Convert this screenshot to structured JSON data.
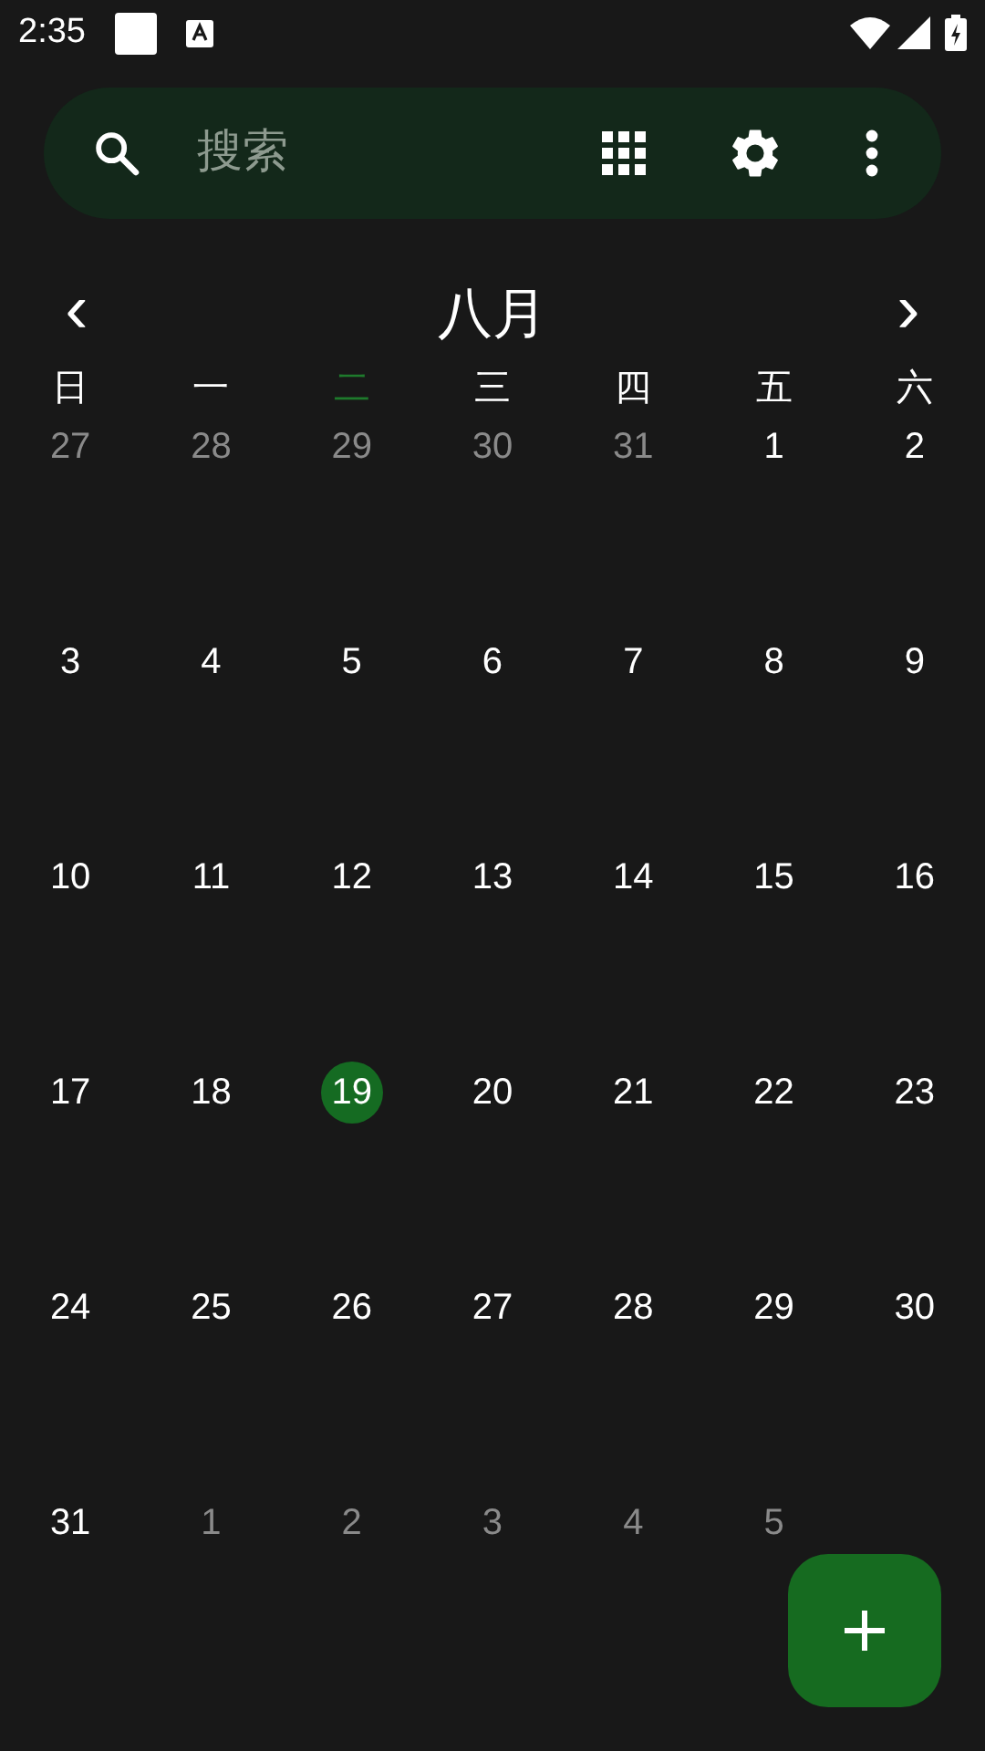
{
  "status_bar": {
    "time": "2:35"
  },
  "search": {
    "placeholder": "搜索"
  },
  "month": {
    "title": "八月",
    "prev": "‹",
    "next": "›"
  },
  "weekdays": [
    {
      "label": "日",
      "selected": false
    },
    {
      "label": "一",
      "selected": false
    },
    {
      "label": "二",
      "selected": true
    },
    {
      "label": "三",
      "selected": false
    },
    {
      "label": "四",
      "selected": false
    },
    {
      "label": "五",
      "selected": false
    },
    {
      "label": "六",
      "selected": false
    }
  ],
  "weeks": [
    [
      {
        "day": "27",
        "in_month": false,
        "selected": false
      },
      {
        "day": "28",
        "in_month": false,
        "selected": false
      },
      {
        "day": "29",
        "in_month": false,
        "selected": false
      },
      {
        "day": "30",
        "in_month": false,
        "selected": false
      },
      {
        "day": "31",
        "in_month": false,
        "selected": false
      },
      {
        "day": "1",
        "in_month": true,
        "selected": false
      },
      {
        "day": "2",
        "in_month": true,
        "selected": false
      }
    ],
    [
      {
        "day": "3",
        "in_month": true,
        "selected": false
      },
      {
        "day": "4",
        "in_month": true,
        "selected": false
      },
      {
        "day": "5",
        "in_month": true,
        "selected": false
      },
      {
        "day": "6",
        "in_month": true,
        "selected": false
      },
      {
        "day": "7",
        "in_month": true,
        "selected": false
      },
      {
        "day": "8",
        "in_month": true,
        "selected": false
      },
      {
        "day": "9",
        "in_month": true,
        "selected": false
      }
    ],
    [
      {
        "day": "10",
        "in_month": true,
        "selected": false
      },
      {
        "day": "11",
        "in_month": true,
        "selected": false
      },
      {
        "day": "12",
        "in_month": true,
        "selected": false
      },
      {
        "day": "13",
        "in_month": true,
        "selected": false
      },
      {
        "day": "14",
        "in_month": true,
        "selected": false
      },
      {
        "day": "15",
        "in_month": true,
        "selected": false
      },
      {
        "day": "16",
        "in_month": true,
        "selected": false
      }
    ],
    [
      {
        "day": "17",
        "in_month": true,
        "selected": false
      },
      {
        "day": "18",
        "in_month": true,
        "selected": false
      },
      {
        "day": "19",
        "in_month": true,
        "selected": true
      },
      {
        "day": "20",
        "in_month": true,
        "selected": false
      },
      {
        "day": "21",
        "in_month": true,
        "selected": false
      },
      {
        "day": "22",
        "in_month": true,
        "selected": false
      },
      {
        "day": "23",
        "in_month": true,
        "selected": false
      }
    ],
    [
      {
        "day": "24",
        "in_month": true,
        "selected": false
      },
      {
        "day": "25",
        "in_month": true,
        "selected": false
      },
      {
        "day": "26",
        "in_month": true,
        "selected": false
      },
      {
        "day": "27",
        "in_month": true,
        "selected": false
      },
      {
        "day": "28",
        "in_month": true,
        "selected": false
      },
      {
        "day": "29",
        "in_month": true,
        "selected": false
      },
      {
        "day": "30",
        "in_month": true,
        "selected": false
      }
    ],
    [
      {
        "day": "31",
        "in_month": true,
        "selected": false
      },
      {
        "day": "1",
        "in_month": false,
        "selected": false
      },
      {
        "day": "2",
        "in_month": false,
        "selected": false
      },
      {
        "day": "3",
        "in_month": false,
        "selected": false
      },
      {
        "day": "4",
        "in_month": false,
        "selected": false
      },
      {
        "day": "5",
        "in_month": false,
        "selected": false
      }
    ]
  ]
}
